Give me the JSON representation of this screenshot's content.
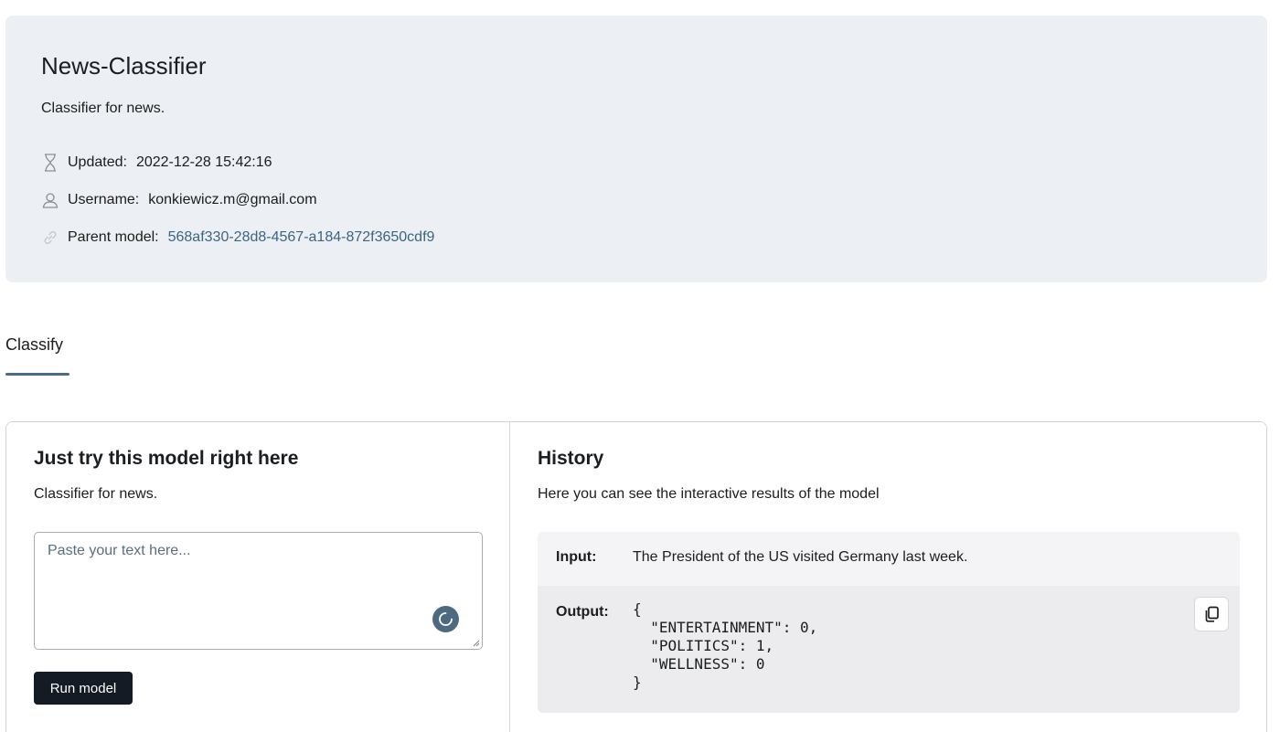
{
  "header": {
    "title": "News-Classifier",
    "description": "Classifier for news.",
    "updated_label": "Updated:",
    "updated_value": "2022-12-28 15:42:16",
    "username_label": "Username:",
    "username_value": "konkiewicz.m@gmail.com",
    "parent_label": "Parent model:",
    "parent_value": "568af330-28d8-4567-a184-872f3650cdf9"
  },
  "tabs": [
    {
      "label": "Classify",
      "active": true
    }
  ],
  "try_panel": {
    "title": "Just try this model right here",
    "description": "Classifier for news.",
    "input_placeholder": "Paste your text here...",
    "input_value": "",
    "run_button_label": "Run model"
  },
  "history": {
    "title": "History",
    "description": "Here you can see the interactive results of the model",
    "input_label": "Input:",
    "input_value": "The President of the US visited Germany last week.",
    "output_label": "Output:",
    "output_value": "{\n  \"ENTERTAINMENT\": 0,\n  \"POLITICS\": 1,\n  \"WELLNESS\": 0\n}"
  },
  "colors": {
    "header_bg": "#eceff4",
    "link": "#3d6580",
    "accent": "#4a6a85",
    "button_dark": "#151b24"
  },
  "icons": {
    "updated": "hourglass-icon",
    "username": "user-icon",
    "parent": "link-icon",
    "loading": "spinner-icon",
    "copy": "copy-icon"
  }
}
